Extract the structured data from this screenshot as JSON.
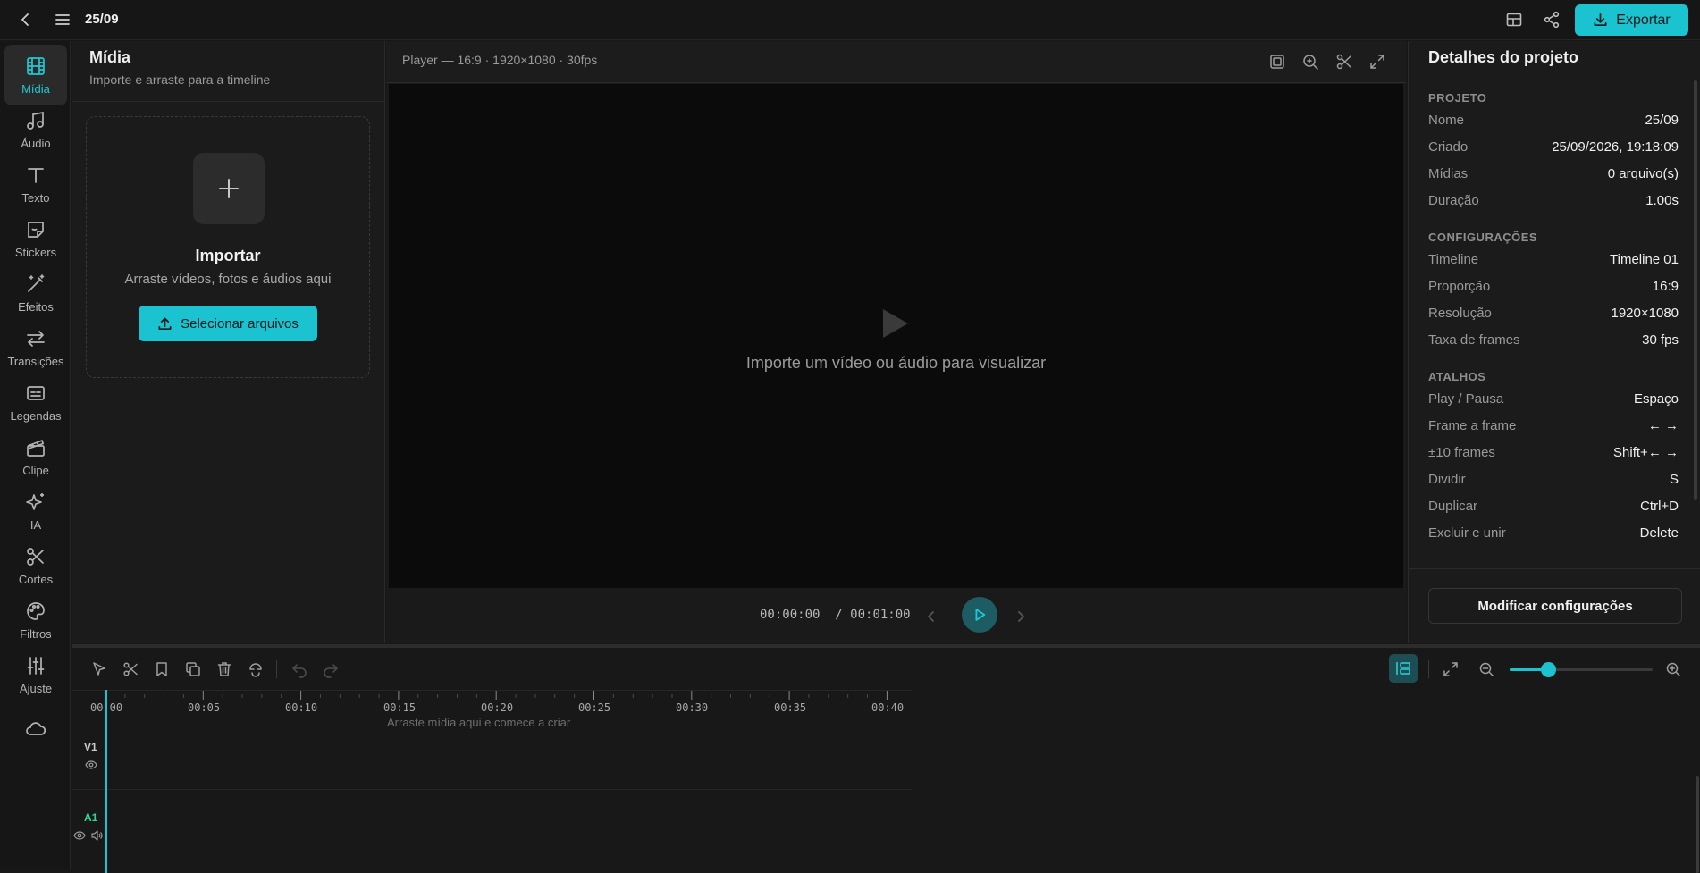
{
  "topbar": {
    "title": "25/09",
    "export_label": "Exportar"
  },
  "rail": {
    "items": [
      {
        "label": "Mídia",
        "icon": "film-icon",
        "active": true
      },
      {
        "label": "Áudio",
        "icon": "music-note-icon"
      },
      {
        "label": "Texto",
        "icon": "text-icon"
      },
      {
        "label": "Stickers",
        "icon": "sticker-icon"
      },
      {
        "label": "Efeitos",
        "icon": "magic-wand-icon"
      },
      {
        "label": "Transições",
        "icon": "transition-arrows-icon"
      },
      {
        "label": "Legendas",
        "icon": "captions-icon"
      },
      {
        "label": "Clipe",
        "icon": "clapperboard-icon"
      },
      {
        "label": "IA",
        "icon": "sparkles-icon"
      },
      {
        "label": "Cortes",
        "icon": "scissors-icon"
      },
      {
        "label": "Filtros",
        "icon": "palette-icon"
      },
      {
        "label": "Ajuste",
        "icon": "sliders-icon"
      }
    ]
  },
  "media": {
    "title": "Mídia",
    "subtitle": "Importe e arraste para a timeline",
    "import_title": "Importar",
    "import_subtitle": "Arraste vídeos, fotos e áudios aqui",
    "select_button": "Selecionar arquivos"
  },
  "player": {
    "label": "Player — 16:9 · 1920×1080 · 30fps",
    "empty_message": "Importe um vídeo ou áudio para visualizar",
    "current_time": "00:00:00",
    "total_time": "/ 00:01:00"
  },
  "details": {
    "title": "Detalhes do projeto",
    "sections": [
      {
        "title": "PROJETO",
        "rows": [
          {
            "key": "Nome",
            "value": "25/09"
          },
          {
            "key": "Criado",
            "value": "25/09/2026, 19:18:09"
          },
          {
            "key": "Mídias",
            "value": "0 arquivo(s)"
          },
          {
            "key": "Duração",
            "value": "1.00s"
          }
        ]
      },
      {
        "title": "CONFIGURAÇÕES",
        "rows": [
          {
            "key": "Timeline",
            "value": "Timeline 01"
          },
          {
            "key": "Proporção",
            "value": "16:9"
          },
          {
            "key": "Resolução",
            "value": "1920×1080"
          },
          {
            "key": "Taxa de frames",
            "value": "30 fps"
          }
        ]
      },
      {
        "title": "ATALHOS",
        "rows": [
          {
            "key": "Play / Pausa",
            "value": "Espaço"
          },
          {
            "key": "Frame a frame",
            "value": "← →"
          },
          {
            "key": "±10 frames",
            "value": "Shift+← →"
          },
          {
            "key": "Dividir",
            "value": "S"
          },
          {
            "key": "Duplicar",
            "value": "Ctrl+D"
          },
          {
            "key": "Excluir e unir",
            "value": "Delete"
          }
        ]
      }
    ],
    "modify_button": "Modificar configurações"
  },
  "timeline": {
    "ticks": [
      "00:00",
      "00:05",
      "00:10",
      "00:15",
      "00:20",
      "00:25",
      "00:30",
      "00:35",
      "00:40"
    ],
    "drop_hint": "Arraste mídia aqui e comece a criar",
    "tracks": [
      {
        "label": "V1",
        "type": "video"
      },
      {
        "label": "A1",
        "type": "audio"
      }
    ],
    "zoom_level": 0.27
  },
  "colors": {
    "accent": "#1bc2cf",
    "background": "#181818",
    "audio_label": "#34d39a"
  }
}
